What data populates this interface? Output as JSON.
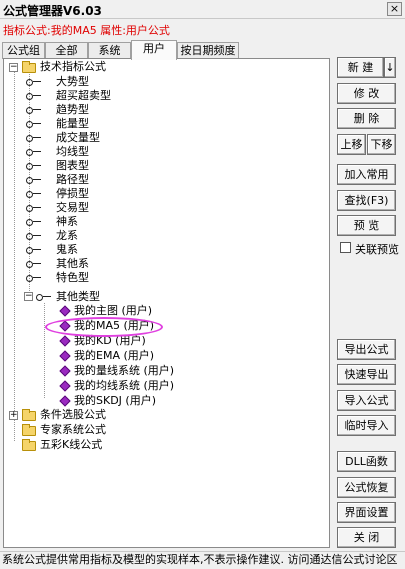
{
  "window": {
    "title": "公式管理器V6.03",
    "close": "×"
  },
  "info": {
    "text": "指标公式:我的MA5 属性:用户公式"
  },
  "tabs": [
    {
      "label": "公式组"
    },
    {
      "label": "全部"
    },
    {
      "label": "系统"
    },
    {
      "label": "用户"
    },
    {
      "label": "按日期频度"
    }
  ],
  "tree": {
    "root1": "技术指标公式",
    "cats": [
      "大势型",
      "超买超卖型",
      "趋势型",
      "能量型",
      "成交量型",
      "均线型",
      "图表型",
      "路径型",
      "停损型",
      "交易型",
      "神系",
      "龙系",
      "鬼系",
      "其他系",
      "特色型"
    ],
    "other": "其他类型",
    "user_items": [
      "我的主图 (用户)",
      "我的MA5 (用户)",
      "我的KD (用户)",
      "我的EMA (用户)",
      "我的量线系统 (用户)",
      "我的均线系统 (用户)",
      "我的SKDJ (用户)"
    ],
    "root2": "条件选股公式",
    "root3": "专家系统公式",
    "root4": "五彩K线公式"
  },
  "buttons": {
    "new": "新 建",
    "new_arrow": "↓",
    "modify": "修 改",
    "delete": "删 除",
    "move_up": "上移",
    "move_down": "下移",
    "add_common": "加入常用",
    "find": "查找(F3)",
    "preview": "预 览",
    "linked_preview": "关联预览",
    "export": "导出公式",
    "quick_export": "快速导出",
    "import": "导入公式",
    "temp_import": "临时导入",
    "dll": "DLL函数",
    "restore": "公式恢复",
    "ui_settings": "界面设置",
    "close": "关 闭"
  },
  "status": {
    "text": "系统公式提供常用指标及模型的实现样本,不表示操作建议. 访问通达信公式讨论区"
  }
}
